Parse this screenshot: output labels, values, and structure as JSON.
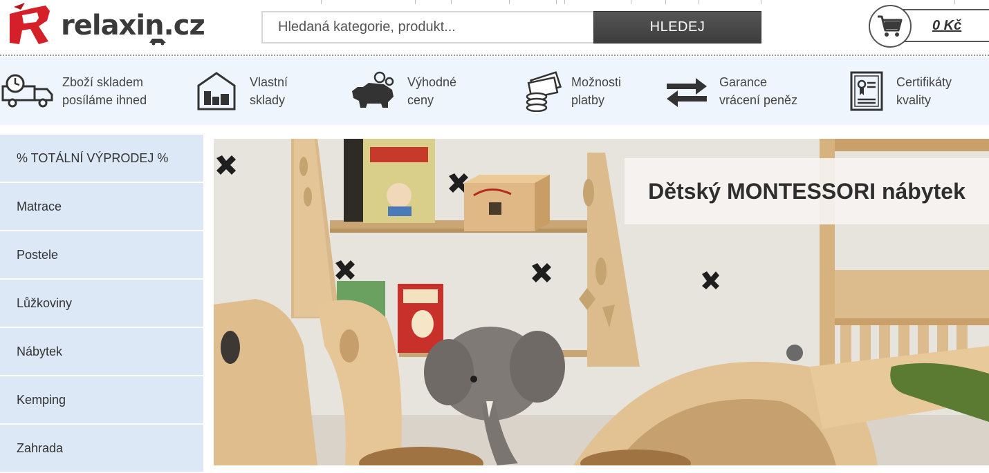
{
  "logo": {
    "text": "relaxin.cz"
  },
  "search": {
    "placeholder": "Hledaná kategorie, produkt...",
    "button_label": "HLEDEJ"
  },
  "cart": {
    "price": "0 Kč"
  },
  "benefits": [
    {
      "icon": "delivery-truck-icon",
      "text": "Zboží skladem\nposíláme ihned"
    },
    {
      "icon": "warehouse-icon",
      "text": "Vlastní\nsklady"
    },
    {
      "icon": "piggy-bank-icon",
      "text": "Výhodné\nceny"
    },
    {
      "icon": "money-icon",
      "text": "Možnosti\nplatby"
    },
    {
      "icon": "exchange-arrows-icon",
      "text": "Garance\nvrácení peněz"
    },
    {
      "icon": "certificate-icon",
      "text": "Certifikáty\nkvality"
    }
  ],
  "sidebar": {
    "items": [
      {
        "label": "% TOTÁLNÍ VÝPRODEJ %"
      },
      {
        "label": "Matrace"
      },
      {
        "label": "Postele"
      },
      {
        "label": "Lůžkoviny"
      },
      {
        "label": "Nábytek"
      },
      {
        "label": "Kemping"
      },
      {
        "label": "Zahrada"
      }
    ]
  },
  "banner": {
    "caption": "Dětský MONTESSORI nábytek"
  },
  "colors": {
    "accent_red": "#d5202a",
    "button_dark": "#444444",
    "benefit_bg": "#eef5fd",
    "sidebar_bg": "#dde8f6"
  }
}
